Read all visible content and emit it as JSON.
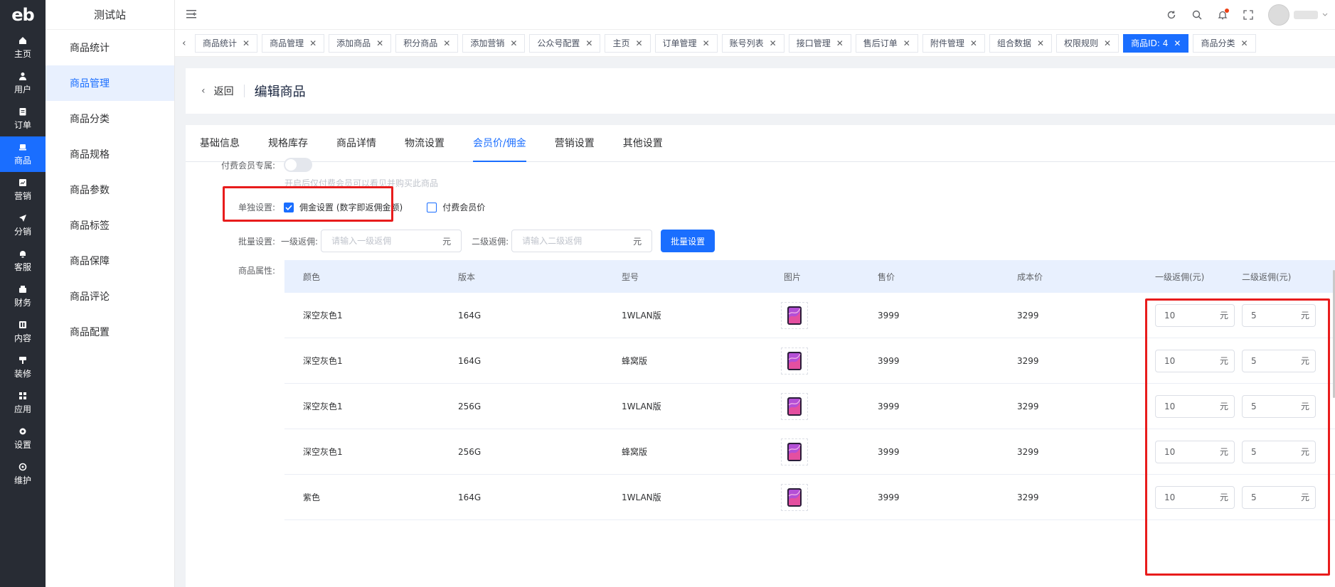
{
  "brand": {
    "logo": "eb",
    "accent": "#1a6eff",
    "highlight": "#e81c1c"
  },
  "rail": [
    {
      "label": "主页",
      "icon": "home-icon"
    },
    {
      "label": "用户",
      "icon": "user-icon"
    },
    {
      "label": "订单",
      "icon": "order-icon"
    },
    {
      "label": "商品",
      "icon": "product-icon",
      "active": true
    },
    {
      "label": "营销",
      "icon": "marketing-icon"
    },
    {
      "label": "分销",
      "icon": "distribution-icon"
    },
    {
      "label": "客服",
      "icon": "service-icon"
    },
    {
      "label": "财务",
      "icon": "finance-icon"
    },
    {
      "label": "内容",
      "icon": "content-icon"
    },
    {
      "label": "装修",
      "icon": "decorate-icon"
    },
    {
      "label": "应用",
      "icon": "apps-icon"
    },
    {
      "label": "设置",
      "icon": "settings-icon"
    },
    {
      "label": "维护",
      "icon": "maintenance-icon"
    }
  ],
  "submenu": {
    "site": "测试站",
    "items": [
      "商品统计",
      "商品管理",
      "商品分类",
      "商品规格",
      "商品参数",
      "商品标签",
      "商品保障",
      "商品评论",
      "商品配置"
    ]
  },
  "tags": [
    "商品统计",
    "商品管理",
    "添加商品",
    "积分商品",
    "添加营销",
    "公众号配置",
    "主页",
    "订单管理",
    "账号列表",
    "接口管理",
    "售后订单",
    "附件管理",
    "组合数据",
    "权限规则",
    "商品ID: 4",
    "商品分类"
  ],
  "page": {
    "back": "返回",
    "title": "编辑商品"
  },
  "tabs": [
    "基础信息",
    "规格库存",
    "商品详情",
    "物流设置",
    "会员价/佣金",
    "营销设置",
    "其他设置"
  ],
  "form": {
    "paid_member_label": "付费会员专属:",
    "paid_member_hint": "开启后仅付费会员可以看见并购买此商品",
    "single_label": "单独设置:",
    "commission_option": "佣金设置 (数字即返佣金额)",
    "member_price_option": "付费会员价",
    "batch_label": "批量设置:",
    "l1_label": "一级返佣:",
    "l1_placeholder": "请输入一级返佣",
    "l2_label": "二级返佣:",
    "l2_placeholder": "请输入二级返佣",
    "unit": "元",
    "batch_button": "批量设置",
    "attr_label": "商品属性:"
  },
  "table": {
    "headers": [
      "颜色",
      "版本",
      "型号",
      "图片",
      "售价",
      "成本价",
      "一级返佣(元)",
      "二级返佣(元)"
    ],
    "rows": [
      {
        "color": "深空灰色1",
        "version": "164G",
        "model": "1WLAN版",
        "price": "3999",
        "cost": "3299",
        "l1": "10",
        "l2": "5"
      },
      {
        "color": "深空灰色1",
        "version": "164G",
        "model": "蜂窝版",
        "price": "3999",
        "cost": "3299",
        "l1": "10",
        "l2": "5"
      },
      {
        "color": "深空灰色1",
        "version": "256G",
        "model": "1WLAN版",
        "price": "3999",
        "cost": "3299",
        "l1": "10",
        "l2": "5"
      },
      {
        "color": "深空灰色1",
        "version": "256G",
        "model": "蜂窝版",
        "price": "3999",
        "cost": "3299",
        "l1": "10",
        "l2": "5"
      },
      {
        "color": "紫色",
        "version": "164G",
        "model": "1WLAN版",
        "price": "3999",
        "cost": "3299",
        "l1": "10",
        "l2": "5"
      }
    ],
    "unit": "元"
  }
}
